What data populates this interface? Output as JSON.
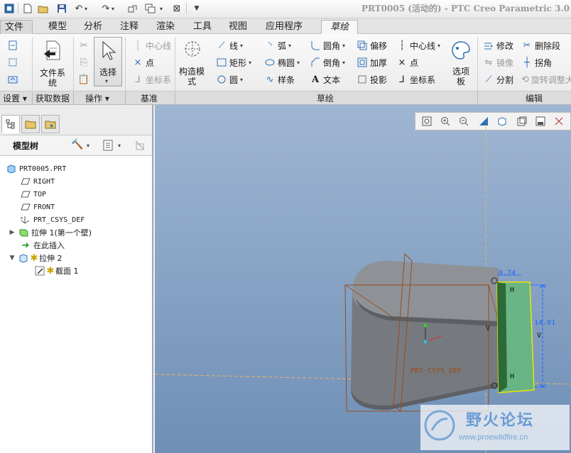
{
  "titlebar": {
    "title": "PRT0005 (活动的) - PTC Creo Parametric 3.0"
  },
  "tabs": [
    {
      "label": "文件 ▾"
    },
    {
      "label": "模型"
    },
    {
      "label": "分析"
    },
    {
      "label": "注释"
    },
    {
      "label": "渲染"
    },
    {
      "label": "工具"
    },
    {
      "label": "视图"
    },
    {
      "label": "应用程序"
    },
    {
      "label": "草绘"
    }
  ],
  "ribbon": {
    "file_system": "文件系统",
    "select": "选择",
    "datum": {
      "centerline": "中心线",
      "point": "点",
      "csys": "坐标系"
    },
    "construction_mode": "构造模式",
    "sketch": {
      "line": "线",
      "rectangle": "矩形",
      "circle": "圆",
      "arc": "弧",
      "ellipse": "椭圆",
      "spline": "样条",
      "fillet": "圆角",
      "chamfer": "倒角",
      "text": "文本",
      "offset": "偏移",
      "thicken": "加厚",
      "project": "投影",
      "centerline": "中心线",
      "point": "点",
      "csys": "坐标系",
      "palette": "选项板"
    },
    "edit": {
      "modify": "修改",
      "delete_segment": "删除段",
      "mirror": "镜像",
      "corner": "拐角",
      "divide": "分割",
      "rotate_resize": "旋转调整大小"
    }
  },
  "groups": [
    "设置 ▾",
    "获取数据",
    "操作 ▾",
    "基准",
    "草绘",
    "编辑"
  ],
  "panel": {
    "tree_title": "模型树",
    "items": [
      {
        "label": "PRT0005.PRT"
      },
      {
        "label": "RIGHT"
      },
      {
        "label": "TOP"
      },
      {
        "label": "FRONT"
      },
      {
        "label": "PRT_CSYS_DEF"
      },
      {
        "label": "拉伸 1(第一个壁)"
      },
      {
        "label": "在此插入"
      },
      {
        "label": "拉伸 2"
      },
      {
        "label": "截面 1"
      }
    ]
  },
  "graphics": {
    "dim_top": "0.74",
    "dim_height": "14.01",
    "csys_label": "PRT_CSYS_DEF",
    "constraint_h": "H",
    "constraint_v": "V"
  },
  "watermark": {
    "title": "野火论坛",
    "url": "www.proewildfire.cn"
  }
}
